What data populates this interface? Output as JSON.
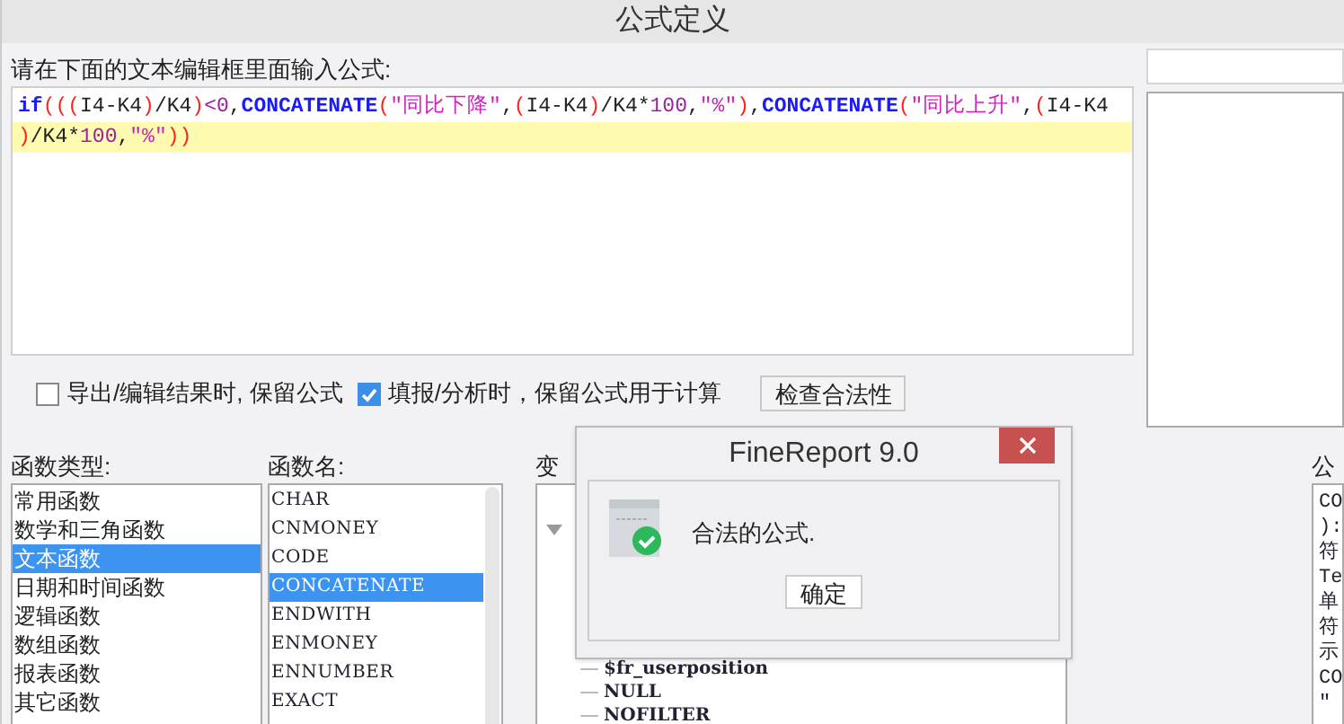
{
  "window": {
    "title": "公式定义"
  },
  "editor": {
    "label": "请在下面的文本编辑框里面输入公式:",
    "lines": [
      {
        "current": false,
        "tokens": [
          {
            "kind": "function",
            "text": "if"
          },
          {
            "kind": "paren",
            "text": "((("
          },
          {
            "kind": "ident",
            "text": "I4-K4"
          },
          {
            "kind": "paren",
            "text": ")"
          },
          {
            "kind": "ident",
            "text": "/K4"
          },
          {
            "kind": "paren",
            "text": ")"
          },
          {
            "kind": "number",
            "text": "<0"
          },
          {
            "kind": "ident",
            "text": ","
          },
          {
            "kind": "function",
            "text": "CONCATENATE"
          },
          {
            "kind": "paren",
            "text": "("
          },
          {
            "kind": "string",
            "text": "\"同比下降\""
          },
          {
            "kind": "ident",
            "text": ","
          },
          {
            "kind": "paren",
            "text": "("
          },
          {
            "kind": "ident",
            "text": "I4-K4"
          },
          {
            "kind": "paren",
            "text": ")"
          },
          {
            "kind": "ident",
            "text": "/K4*"
          },
          {
            "kind": "number",
            "text": "100"
          },
          {
            "kind": "ident",
            "text": ","
          },
          {
            "kind": "string",
            "text": "\"%\""
          },
          {
            "kind": "paren",
            "text": ")"
          },
          {
            "kind": "ident",
            "text": ","
          },
          {
            "kind": "function",
            "text": "CONCATENATE"
          },
          {
            "kind": "paren",
            "text": "("
          },
          {
            "kind": "string",
            "text": "\"同比上升\""
          },
          {
            "kind": "ident",
            "text": ","
          },
          {
            "kind": "paren",
            "text": "("
          },
          {
            "kind": "ident",
            "text": "I4-K4"
          }
        ]
      },
      {
        "current": true,
        "tokens": [
          {
            "kind": "paren",
            "text": ")"
          },
          {
            "kind": "ident",
            "text": "/K4*"
          },
          {
            "kind": "number",
            "text": "100"
          },
          {
            "kind": "ident",
            "text": ","
          },
          {
            "kind": "string",
            "text": "\"%\""
          },
          {
            "kind": "paren",
            "text": "))"
          }
        ]
      }
    ]
  },
  "options": [
    {
      "label": "导出/编辑结果时, 保留公式",
      "checked": false
    },
    {
      "label": "填报/分析时，保留公式用于计算",
      "checked": true
    }
  ],
  "check_button": "检查合法性",
  "function_types": {
    "label": "函数类型:",
    "items": [
      {
        "label": "常用函数",
        "selected": false
      },
      {
        "label": "数学和三角函数",
        "selected": false
      },
      {
        "label": "文本函数",
        "selected": true
      },
      {
        "label": "日期和时间函数",
        "selected": false
      },
      {
        "label": "逻辑函数",
        "selected": false
      },
      {
        "label": "数组函数",
        "selected": false
      },
      {
        "label": "报表函数",
        "selected": false
      },
      {
        "label": "其它函数",
        "selected": false
      }
    ]
  },
  "function_names": {
    "label": "函数名:",
    "items": [
      {
        "label": "CHAR",
        "selected": false
      },
      {
        "label": "CNMONEY",
        "selected": false
      },
      {
        "label": "CODE",
        "selected": false
      },
      {
        "label": "CONCATENATE",
        "selected": true
      },
      {
        "label": "ENDWITH",
        "selected": false
      },
      {
        "label": "ENMONEY",
        "selected": false
      },
      {
        "label": "ENNUMBER",
        "selected": false
      },
      {
        "label": "EXACT",
        "selected": false
      }
    ]
  },
  "variables": {
    "label": "变",
    "items": [
      "$fr_userposition",
      "NULL",
      "NOFILTER"
    ]
  },
  "description": {
    "label": "公",
    "lines": [
      "CO",
      "):",
      "符",
      "Te",
      "单",
      "符",
      "示",
      "CO",
      "\""
    ]
  },
  "dialog": {
    "title": "FineReport 9.0",
    "message": "合法的公式.",
    "button": "确定"
  }
}
